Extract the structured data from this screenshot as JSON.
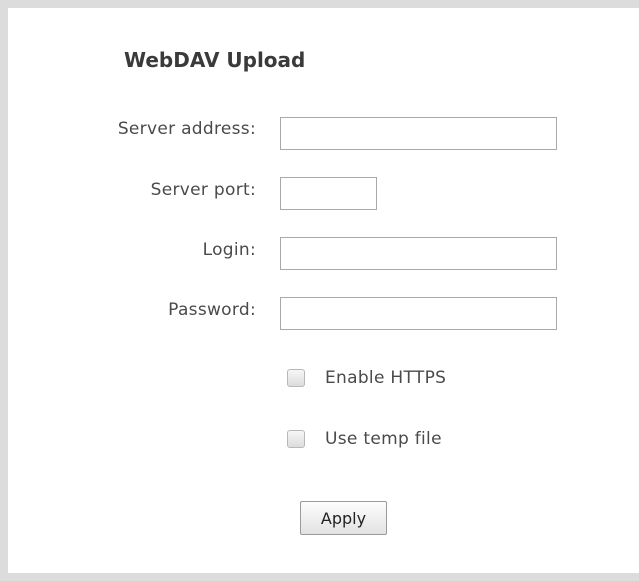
{
  "panel": {
    "title": "WebDAV Upload"
  },
  "fields": {
    "server_address": {
      "label": "Server address:",
      "value": ""
    },
    "server_port": {
      "label": "Server port:",
      "value": ""
    },
    "login": {
      "label": "Login:",
      "value": ""
    },
    "password": {
      "label": "Password:",
      "value": ""
    }
  },
  "options": {
    "enable_https": {
      "label": "Enable HTTPS",
      "checked": false
    },
    "use_temp_file": {
      "label": "Use temp file",
      "checked": false
    }
  },
  "actions": {
    "apply_label": "Apply"
  },
  "colors": {
    "page_background": "#dcdcdc",
    "panel_background": "#ffffff",
    "label_text": "#4a4a4a",
    "field_border": "#a9a9a9"
  }
}
